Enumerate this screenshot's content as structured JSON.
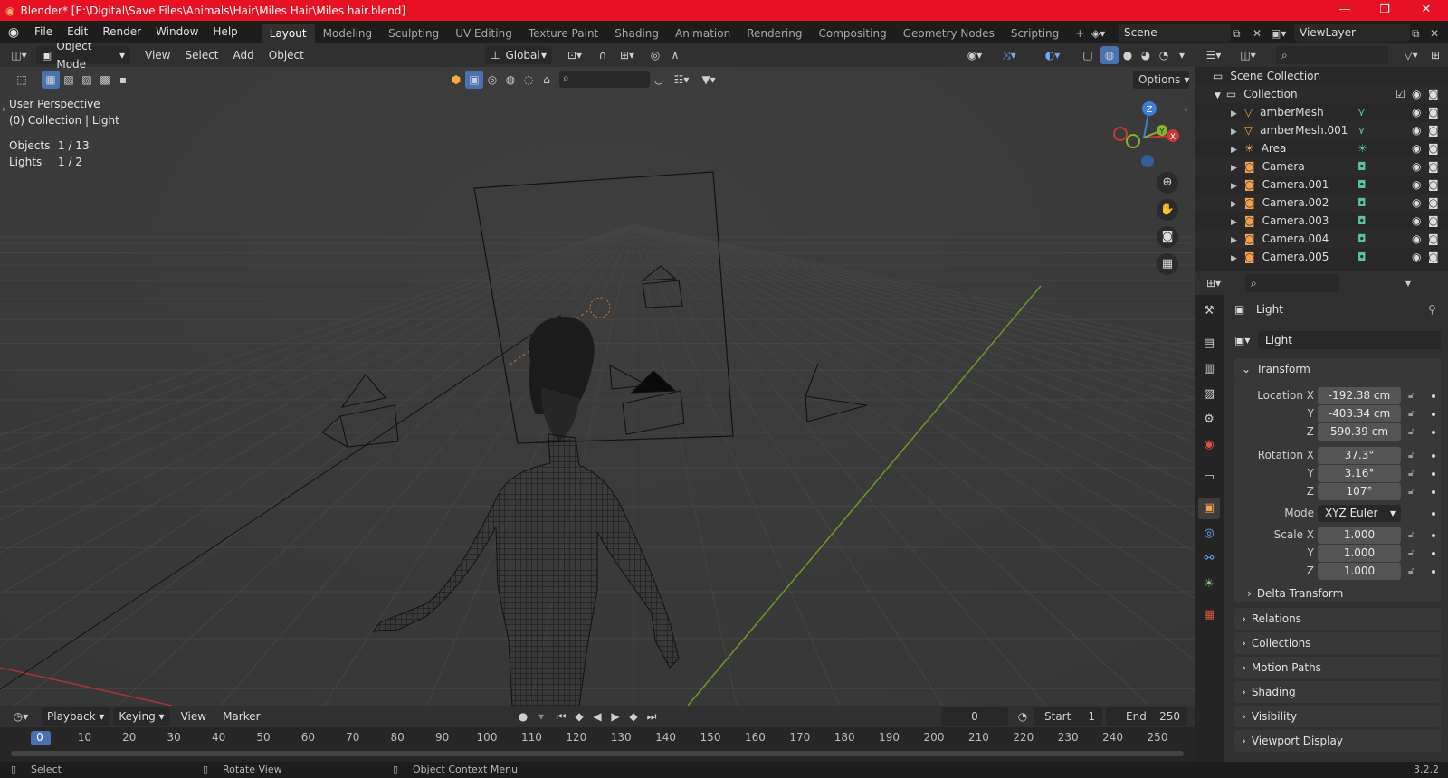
{
  "window": {
    "title": "Blender* [E:\\Digital\\Save Files\\Animals\\Hair\\Miles Hair\\Miles hair.blend]",
    "minimize": "—",
    "restore": "❐",
    "close": "✕"
  },
  "menu": [
    "File",
    "Edit",
    "Render",
    "Window",
    "Help"
  ],
  "workspaces": [
    "Layout",
    "Modeling",
    "Sculpting",
    "UV Editing",
    "Texture Paint",
    "Shading",
    "Animation",
    "Rendering",
    "Compositing",
    "Geometry Nodes",
    "Scripting"
  ],
  "active_workspace": "Layout",
  "add_workspace": "+",
  "scene": "Scene",
  "view_layer": "ViewLayer",
  "viewport": {
    "mode": "Object Mode",
    "menus": [
      "View",
      "Select",
      "Add",
      "Object"
    ],
    "orientation": "Global",
    "options": "Options",
    "overlay_lines": [
      "User Perspective",
      "(0) Collection | Light"
    ],
    "stats": [
      {
        "label": "Objects",
        "value": "1 / 13"
      },
      {
        "label": "Lights",
        "value": "1 / 2"
      }
    ],
    "gizmo_axes": {
      "z": "Z",
      "y": "Y",
      "x": "X"
    },
    "colors": {
      "x_axis": "#c8393c",
      "y_axis": "#86b626",
      "z_axis": "#3b80d9"
    }
  },
  "timeline": {
    "menus": [
      "Playback",
      "Keying",
      "View",
      "Marker"
    ],
    "current_frame": "0",
    "start_label": "Start",
    "start": "1",
    "end_label": "End",
    "end": "250",
    "ruler": [
      "0",
      "10",
      "20",
      "30",
      "40",
      "50",
      "60",
      "70",
      "80",
      "90",
      "100",
      "110",
      "120",
      "130",
      "140",
      "150",
      "160",
      "170",
      "180",
      "190",
      "200",
      "210",
      "220",
      "230",
      "240",
      "250"
    ]
  },
  "status": {
    "select": "Select",
    "rotate": "Rotate View",
    "context": "Object Context Menu",
    "version": "3.2.2"
  },
  "outliner": {
    "scene_collection": "Scene Collection",
    "collection": "Collection",
    "items": [
      {
        "name": "amberMesh",
        "type": "mesh"
      },
      {
        "name": "amberMesh.001",
        "type": "mesh"
      },
      {
        "name": "Area",
        "type": "light"
      },
      {
        "name": "Camera",
        "type": "camera"
      },
      {
        "name": "Camera.001",
        "type": "camera"
      },
      {
        "name": "Camera.002",
        "type": "camera"
      },
      {
        "name": "Camera.003",
        "type": "camera"
      },
      {
        "name": "Camera.004",
        "type": "camera"
      },
      {
        "name": "Camera.005",
        "type": "camera"
      }
    ]
  },
  "properties": {
    "object_name": "Light",
    "datablock": "Light",
    "transform_title": "Transform",
    "location": {
      "label": "Location X",
      "x": "-192.38 cm",
      "y": "-403.34 cm",
      "z": "590.39 cm"
    },
    "rotation": {
      "label": "Rotation X",
      "x": "37.3°",
      "y": "3.16°",
      "z": "107°"
    },
    "mode_label": "Mode",
    "mode_value": "XYZ Euler",
    "scale": {
      "label": "Scale X",
      "x": "1.000",
      "y": "1.000",
      "z": "1.000"
    },
    "axis_y": "Y",
    "axis_z": "Z",
    "delta_transform": "Delta Transform",
    "sections": [
      "Relations",
      "Collections",
      "Motion Paths",
      "Shading",
      "Visibility",
      "Viewport Display"
    ]
  }
}
